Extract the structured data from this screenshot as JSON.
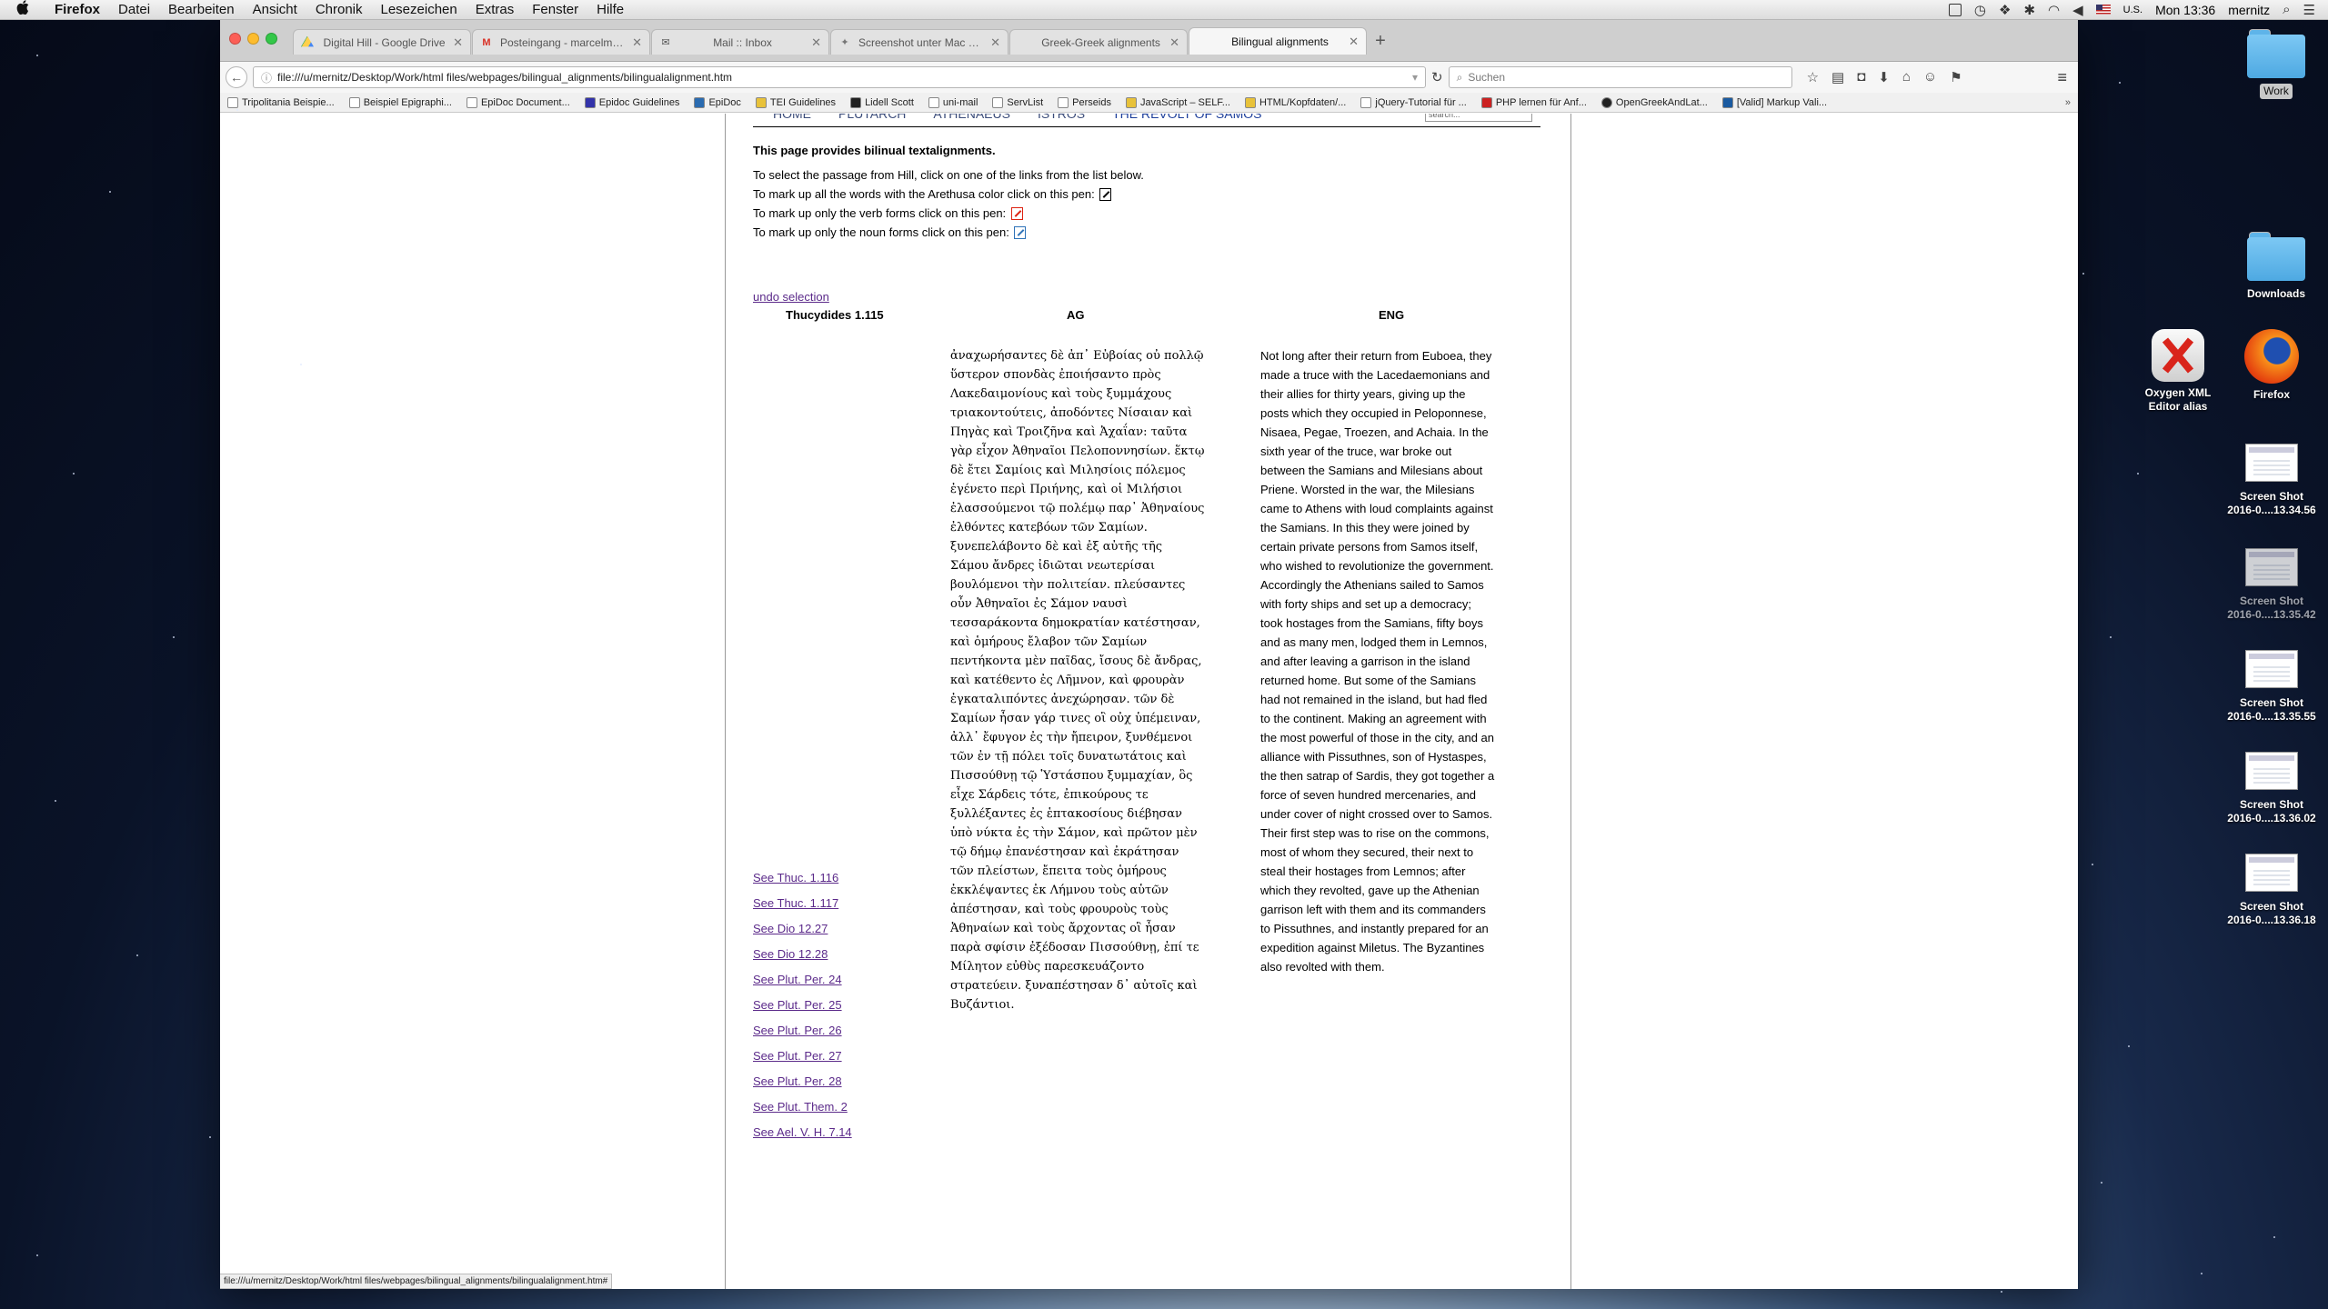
{
  "menubar": {
    "apple": "",
    "items": [
      "Firefox",
      "Datei",
      "Bearbeiten",
      "Ansicht",
      "Chronik",
      "Lesezeichen",
      "Extras",
      "Fenster",
      "Hilfe"
    ],
    "input_source": "U.S.",
    "clock": "Mon 13:36",
    "user": "mernitz"
  },
  "browser": {
    "tabs": [
      {
        "title": "Digital Hill - Google Drive",
        "icon": "google-drive-icon",
        "icon_color": "#f2b600"
      },
      {
        "title": "Posteingang - marcelmernit...",
        "icon": "gmail-icon",
        "icon_color": "#d93025"
      },
      {
        "title": "Mail :: Inbox",
        "icon": "mail-icon",
        "icon_color": "#555555"
      },
      {
        "title": "Screenshot unter Mac OS -...",
        "icon": "puzzle-icon",
        "icon_color": "#777777"
      },
      {
        "title": "Greek-Greek alignments",
        "icon": "none",
        "icon_color": "#cccccc"
      },
      {
        "title": "Bilingual alignments",
        "icon": "none",
        "icon_color": "#cccccc"
      }
    ],
    "url": "file:///u/mernitz/Desktop/Work/html files/webpages/bilingual_alignments/bilingualalignment.htm",
    "search_placeholder": "Suchen",
    "bookmarks": [
      "Tripolitania Beispie...",
      "Beispiel Epigraphi...",
      "EpiDoc Document...",
      "Epidoc Guidelines",
      "EpiDoc",
      "TEI Guidelines",
      "Lidell Scott",
      "uni-mail",
      "ServList",
      "Perseids",
      "JavaScript – SELF...",
      "HTML/Kopfdaten/...",
      "jQuery-Tutorial für ...",
      "PHP lernen für Anf...",
      "OpenGreekAndLat...",
      "[Valid] Markup Vali..."
    ],
    "bookmarks_more": "»",
    "status_url": "file:///u/mernitz/Desktop/Work/html files/webpages/bilingual_alignments/bilingualalignment.htm#"
  },
  "page": {
    "nav": [
      "HOME",
      "PLUTARCH",
      "ATHENAEUS",
      "ISTROS",
      "THE REVOLT OF SAMOS"
    ],
    "search_placeholder": "search...",
    "heading": "This page provides bilinual textalignments.",
    "instructions": [
      "To select the passage from Hill, click on one of the links from the list below.",
      "To mark up all the words with the Arethusa color click on this pen:",
      "To mark up only the verb forms click on this pen:",
      "To mark up only the noun forms click on this pen:"
    ],
    "undo": "undo selection",
    "col_source": "Thucydides 1.115",
    "col_ag": "AG",
    "col_eng": "ENG",
    "ag_lines": [
      "ἀναχωρήσαντες δὲ ἀπ᾽ Εὐβοίας οὐ πολλῷ",
      "ὕστερον σπονδὰς ἐποιήσαντο πρὸς",
      "Λακεδαιμονίους καὶ τοὺς ξυμμάχους",
      "τριακοντούτεις, ἀποδόντες Νίσαιαν καὶ",
      "Πηγὰς καὶ Τροιζῆνα καὶ Ἀχαΐαν: ταῦτα",
      "γὰρ εἶχον Ἀθηναῖοι Πελοποννησίων. ἕκτῳ",
      "δὲ ἔτει Σαμίοις καὶ Μιλησίοις πόλεμος",
      "ἐγένετο περὶ Πριήνης, καὶ οἱ Μιλήσιοι",
      "ἐλασσούμενοι τῷ πολέμῳ παρ᾽ Ἀθηναίους",
      "ἐλθόντες κατεβόων τῶν Σαμίων.",
      "ξυνεπελάβοντο δὲ καὶ ἐξ αὐτῆς τῆς",
      "Σάμου ἄνδρες ἰδιῶται νεωτερίσαι",
      "βουλόμενοι τὴν πολιτείαν. πλεύσαντες",
      "οὖν Ἀθηναῖοι ἐς Σάμον ναυσὶ",
      "τεσσαράκοντα δημοκρατίαν κατέστησαν,",
      "καὶ ὁμήρους ἔλαβον τῶν Σαμίων",
      "πεντήκοντα μὲν παῖδας, ἴσους δὲ ἄνδρας,",
      "καὶ κατέθεντο ἐς Λῆμνον, καὶ φρουρὰν",
      "ἐγκαταλιπόντες ἀνεχώρησαν. τῶν δὲ",
      "Σαμίων ἦσαν γάρ τινες οἳ οὐχ ὑπέμειναν,",
      "ἀλλ᾽ ἔφυγον ἐς τὴν ἤπειρον, ξυνθέμενοι",
      "τῶν ἐν τῇ πόλει τοῖς δυνατωτάτοις καὶ",
      "Πισσούθνῃ τῷ Ὑστάσπου ξυμμαχίαν, ὃς",
      "εἶχε Σάρδεις τότε, ἐπικούρους τε",
      "ξυλλέξαντες ἐς ἑπτακοσίους διέβησαν",
      "ὑπὸ νύκτα ἐς τὴν Σάμον, καὶ πρῶτον μὲν",
      "τῷ δήμῳ ἐπανέστησαν καὶ ἐκράτησαν",
      "τῶν πλείστων, ἔπειτα τοὺς ὁμήρους",
      "ἐκκλέψαντες ἐκ Λήμνου τοὺς αὑτῶν",
      "ἀπέστησαν, καὶ τοὺς φρουροὺς τοὺς",
      "Ἀθηναίων καὶ τοὺς ἄρχοντας οἳ ἦσαν",
      "παρὰ σφίσιν ἐξέδοσαν Πισσούθνῃ, ἐπί τε",
      "Μίλητον εὐθὺς παρεσκευάζοντο",
      "στρατεύειν. ξυναπέστησαν δ᾽ αὐτοῖς καὶ",
      "Βυζάντιοι."
    ],
    "eng_lines": [
      "Not long after their return from Euboea, they",
      "made a truce with the Lacedaemonians and",
      "their allies for thirty years, giving up the",
      "posts which they occupied in Peloponnese,",
      "Nisaea, Pegae, Troezen, and Achaia. In the",
      "sixth year of the truce, war broke out",
      "between the Samians and Milesians about",
      "Priene. Worsted in the war, the Milesians",
      "came to Athens with loud complaints against",
      "the Samians. In this they were joined by",
      "certain private persons from Samos itself,",
      "who wished to revolutionize the government.",
      "Accordingly the Athenians sailed to Samos",
      "with forty ships and set up a democracy;",
      "took hostages from the Samians, fifty boys",
      "and as many men, lodged them in Lemnos,",
      "and after leaving a garrison in the island",
      "returned home. But some of the Samians",
      "had not remained in the island, but had fled",
      "to the continent. Making an agreement with",
      "the most powerful of those in the city, and an",
      "alliance with Pissuthnes, son of Hystaspes,",
      "the then satrap of Sardis, they got together a",
      "force of seven hundred mercenaries, and",
      "under cover of night crossed over to Samos.",
      "Their first step was to rise on the commons,",
      "most of whom they secured, their next to",
      "steal their hostages from Lemnos; after",
      "which they revolted, gave up the Athenian",
      "garrison left with them and its commanders",
      "to Pissuthnes, and instantly prepared for an",
      "expedition against Miletus. The Byzantines",
      "also revolted with them."
    ],
    "see_links": [
      "See Thuc. 1.116",
      "See Thuc. 1.117",
      "See Dio 12.27",
      "See Dio 12.28",
      "See Plut. Per. 24",
      "See Plut. Per. 25",
      "See Plut. Per. 26",
      "See Plut. Per. 27",
      "See Plut. Per. 28",
      "See Plut. Them. 2",
      "See Ael. V. H. 7.14"
    ]
  },
  "desktop": {
    "icons": [
      {
        "label": "Work",
        "kind": "folder",
        "selected": true
      },
      {
        "label": "Downloads",
        "kind": "folder",
        "selected": false
      },
      {
        "label": "Oxygen XML Editor alias",
        "kind": "oxygen-app-icon",
        "selected": false
      },
      {
        "label": "Firefox",
        "kind": "firefox-app-icon",
        "selected": false
      },
      {
        "label": "Screen Shot 2016-0....13.34.56",
        "kind": "screenshot-file-icon",
        "selected": false
      },
      {
        "label": "Screen Shot 2016-0....13.35.42",
        "kind": "screenshot-file-icon",
        "selected": false
      },
      {
        "label": "Screen Shot 2016-0....13.35.55",
        "kind": "screenshot-file-icon",
        "selected": false
      },
      {
        "label": "Screen Shot 2016-0....13.36.02",
        "kind": "screenshot-file-icon",
        "selected": false
      },
      {
        "label": "Screen Shot 2016-0....13.36.18",
        "kind": "screenshot-file-icon",
        "selected": false
      }
    ]
  },
  "colors": {
    "link_visited": "#5b2a8a",
    "nav_link": "#3b4c7a",
    "pen_red": "#dd2211",
    "pen_blue": "#2f73b8"
  }
}
